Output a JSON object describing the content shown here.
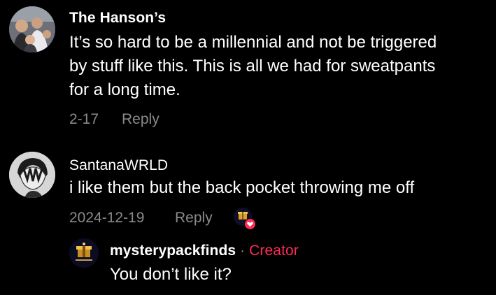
{
  "comments": [
    {
      "username": "The Hanson’s",
      "lines": [
        "It’s so hard to be a millennial and not be triggered",
        "by stuff like this. This is all we had for sweatpants",
        "for a long time."
      ],
      "date": "2-17",
      "reply_label": "Reply"
    },
    {
      "username": "SantanaWRLD",
      "lines": [
        "i like them but the back pocket throwing me off"
      ],
      "date": "2024-12-19",
      "reply_label": "Reply",
      "creator_liked": true
    }
  ],
  "reply": {
    "username": "mysterypackfinds",
    "separator": "·",
    "badge": "Creator",
    "text": "You don’t like it?"
  },
  "colors": {
    "background": "#000000",
    "text": "#ffffff",
    "muted": "#8a8a8a",
    "accent": "#fe2c55"
  }
}
